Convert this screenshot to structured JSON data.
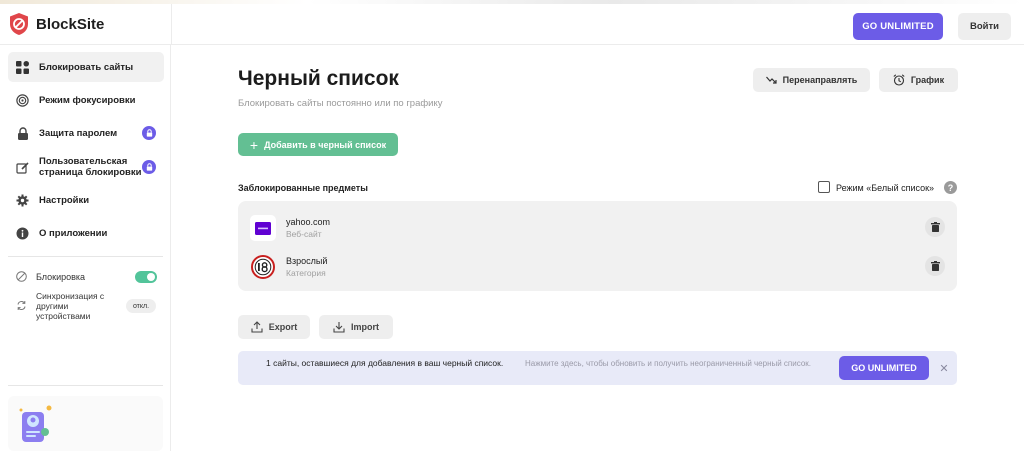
{
  "app": {
    "name": "BlockSite"
  },
  "header": {
    "unlimited_label": "GO UNLIMITED",
    "login_label": "Войти"
  },
  "sidebar": {
    "items": [
      {
        "label": "Блокировать сайты",
        "icon": "grid-icon",
        "active": true
      },
      {
        "label": "Режим фокусировки",
        "icon": "target-icon"
      },
      {
        "label": "Защита паролем",
        "icon": "lock-icon",
        "locked": true
      },
      {
        "label": "Пользовательская страница блокировки",
        "icon": "edit-page-icon",
        "locked": true
      },
      {
        "label": "Настройки",
        "icon": "gear-icon"
      },
      {
        "label": "О приложении",
        "icon": "info-icon"
      }
    ],
    "block_toggle_label": "Блокировка",
    "block_toggle_on": true,
    "sync_label": "Синхронизация с другими устройствами",
    "sync_status": "откл."
  },
  "main": {
    "title": "Черный список",
    "subtitle": "Блокировать сайты постоянно или по графику",
    "redirect_label": "Перенаправлять",
    "schedule_label": "График",
    "add_label": "Добавить в черный список",
    "section_label": "Заблокированные предметы",
    "whitelist_label": "Режим «Белый список»",
    "items": [
      {
        "name": "yahoo.com",
        "type": "Веб-сайт",
        "icon": "yahoo-icon"
      },
      {
        "name": "Взрослый",
        "type": "Категория",
        "icon": "age-18-icon"
      }
    ],
    "export_label": "Export",
    "import_label": "Import"
  },
  "banner": {
    "text": "1 сайты, оставшиеся для добавления в ваш черный список.",
    "upgrade_text": "Нажмите здесь, чтобы обновить и получить неограниченный черный список.",
    "button_label": "GO UNLIMITED"
  },
  "colors": {
    "accent": "#6c5ce7",
    "green": "#63bf93",
    "brand_red": "#e0464a"
  }
}
